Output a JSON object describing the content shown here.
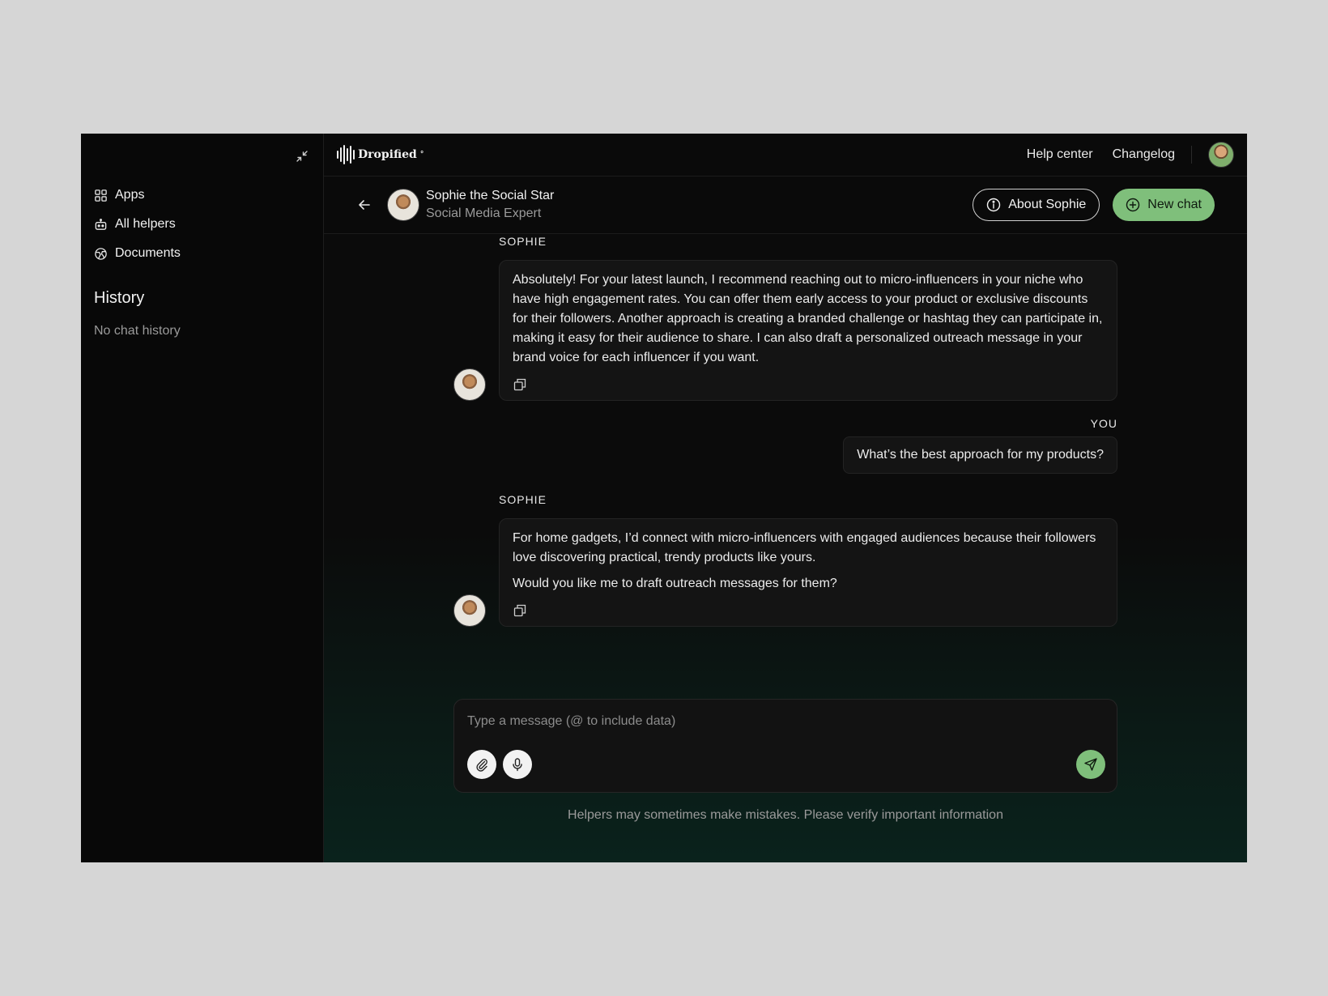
{
  "sidebar": {
    "collapse_icon": "collapse-icon",
    "nav": [
      {
        "label": "Apps",
        "icon": "grid-icon"
      },
      {
        "label": "All helpers",
        "icon": "robot-icon"
      },
      {
        "label": "Documents",
        "icon": "globe-icon"
      }
    ],
    "history_title": "History",
    "history_empty": "No chat history"
  },
  "topbar": {
    "logo_text": "Dropified",
    "logo_mark": "°",
    "help_center": "Help center",
    "changelog": "Changelog"
  },
  "chat_header": {
    "agent_name": "Sophie the Social Star",
    "agent_role": "Social Media Expert",
    "about_label": "About Sophie",
    "new_chat_label": "New chat"
  },
  "messages": [
    {
      "sender": "SOPHIE",
      "paragraphs": [
        "Absolutely! For your latest launch, I recommend reaching out to micro-influencers in your niche who have high engagement rates. You can offer them early access to your product or exclusive discounts for their followers. Another approach is creating a branded challenge or hashtag they can participate in, making it easy for their audience to share. I can also draft a personalized outreach message in your brand voice for each influencer if you want."
      ]
    },
    {
      "sender": "YOU",
      "text": "What’s the best approach for my products?"
    },
    {
      "sender": "SOPHIE",
      "paragraphs": [
        "For home gadgets, I’d connect with micro-influencers with engaged audiences because their followers love discovering practical, trendy products like yours.",
        "Would you like me to draft outreach messages for them?"
      ]
    }
  ],
  "composer": {
    "placeholder": "Type a message (@ to include data)",
    "value": ""
  },
  "disclaimer": "Helpers may sometimes make mistakes. Please verify important information",
  "colors": {
    "accent_green": "#7fbf7b",
    "background": "#070707",
    "bubble": "#141414"
  }
}
